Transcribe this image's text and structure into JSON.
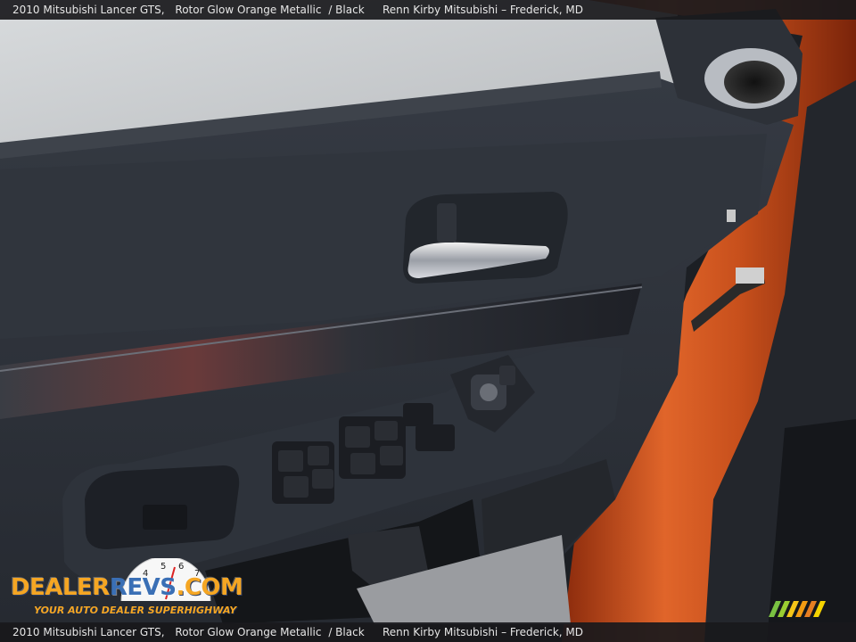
{
  "caption": {
    "vehicle": "2010 Mitsubishi Lancer GTS,",
    "color": "Rotor Glow Orange Metallic",
    "interior": "/ Black",
    "dealer": "Renn Kirby Mitsubishi – Frederick, MD"
  },
  "watermark": {
    "brand_dealer": "DEALER",
    "brand_revs": "REVS",
    "brand_suffix": ".COM",
    "tagline": "YOUR AUTO DEALER SUPERHIGHWAY",
    "speedo_digits": "4 5 6 7"
  },
  "colors": {
    "car_paint": "#c8501c",
    "door_panel": "#2b3038",
    "logo_orange": "#f5a623",
    "logo_blue": "#3a6fb5"
  },
  "icons": {
    "speaker": "tweeter-speaker-icon",
    "handle": "door-handle-icon",
    "window_switch": "window-switch-icon",
    "mirror_control": "mirror-control-icon",
    "stripes": "color-stripes-icon"
  }
}
